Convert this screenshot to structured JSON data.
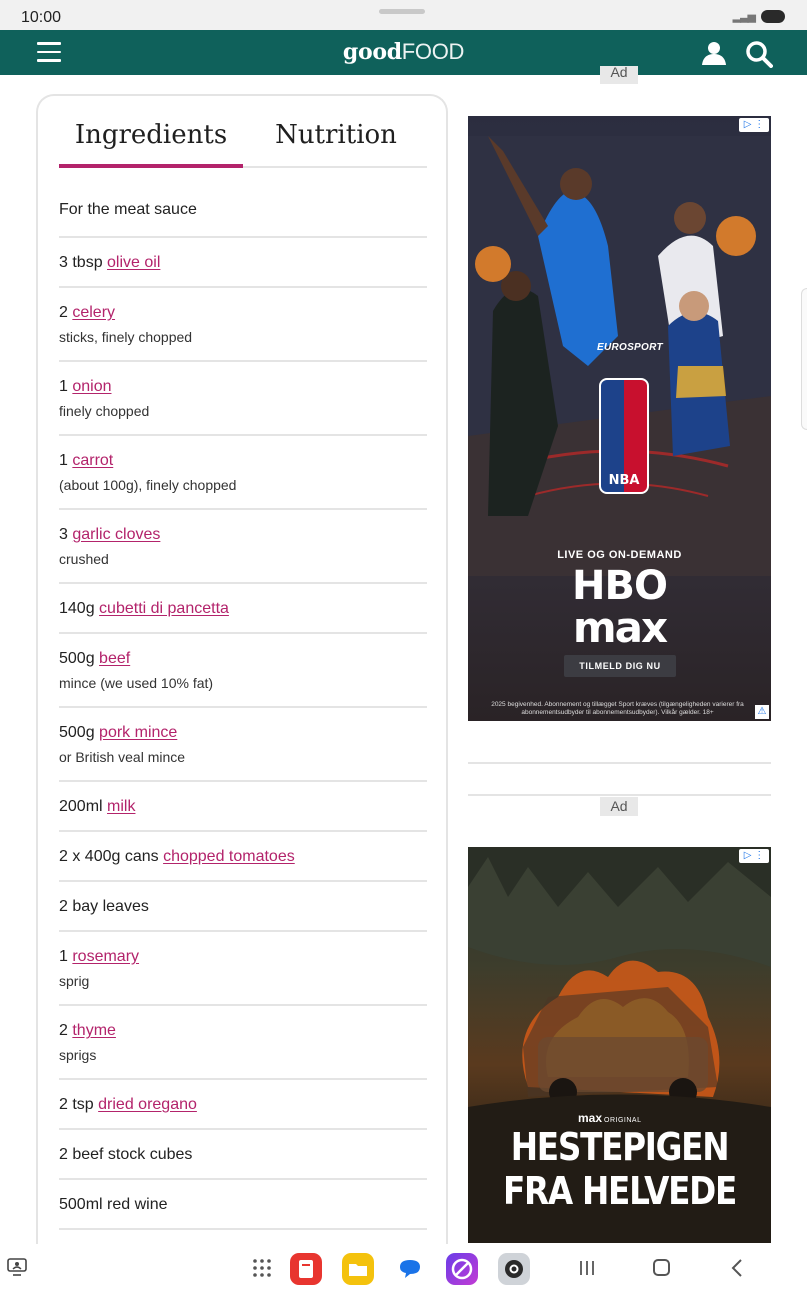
{
  "status": {
    "time": "10:00"
  },
  "header": {
    "brand_bold": "good",
    "brand_light": "FOOD"
  },
  "tabs": {
    "ingredients": "Ingredients",
    "nutrition": "Nutrition"
  },
  "ingredients": {
    "heading": "For the meat sauce",
    "items": [
      {
        "pre": "3 tbsp ",
        "link": "olive oil",
        "post": "",
        "note": ""
      },
      {
        "pre": "2 ",
        "link": "celery",
        "post": "",
        "note": "sticks, finely chopped"
      },
      {
        "pre": "1 ",
        "link": "onion",
        "post": "",
        "note": "finely chopped"
      },
      {
        "pre": "1 ",
        "link": "carrot",
        "post": "",
        "note": "(about 100g), finely chopped"
      },
      {
        "pre": "3 ",
        "link": "garlic cloves",
        "post": "",
        "note": "crushed"
      },
      {
        "pre": "140g ",
        "link": "cubetti di pancetta",
        "post": "",
        "note": ""
      },
      {
        "pre": "500g ",
        "link": "beef",
        "post": "",
        "note": "mince (we used 10% fat)"
      },
      {
        "pre": "500g ",
        "link": "pork mince",
        "post": "",
        "note": "or British veal mince"
      },
      {
        "pre": "200ml ",
        "link": "milk",
        "post": "",
        "note": ""
      },
      {
        "pre": "2 x 400g cans ",
        "link": "chopped tomatoes",
        "post": "",
        "note": ""
      },
      {
        "pre": "2 bay leaves",
        "link": "",
        "post": "",
        "note": ""
      },
      {
        "pre": "1 ",
        "link": "rosemary",
        "post": "",
        "note": "sprig"
      },
      {
        "pre": "2 ",
        "link": "thyme",
        "post": "",
        "note": "sprigs"
      },
      {
        "pre": "2 tsp ",
        "link": "dried oregano",
        "post": "",
        "note": ""
      },
      {
        "pre": "2 beef stock cubes",
        "link": "",
        "post": "",
        "note": ""
      },
      {
        "pre": "500ml red wine",
        "link": "",
        "post": "",
        "note": ""
      }
    ]
  },
  "ads": {
    "label": "Ad",
    "hbo": {
      "eurosport": "EUROSPORT",
      "nba": "NBA",
      "live": "LIVE OG ON-DEMAND",
      "logo_top": "HBO",
      "logo_bottom": "max",
      "cta": "TILMELD DIG NU",
      "disclaimer": "2025 begivenhed. Abonnement og tillægget Sport kræves (tilgængeligheden varierer fra abonnementsudbyder til abonnementsudbyder). Vilkår gælder. 18+"
    },
    "movie": {
      "brand": "max",
      "brand_sub": "ORIGINAL",
      "title_line1": "HESTEPIGEN",
      "title_line2": "FRA HELVEDE"
    }
  },
  "colors": {
    "brand_teal": "#0f615b",
    "accent_magenta": "#b3236b"
  }
}
